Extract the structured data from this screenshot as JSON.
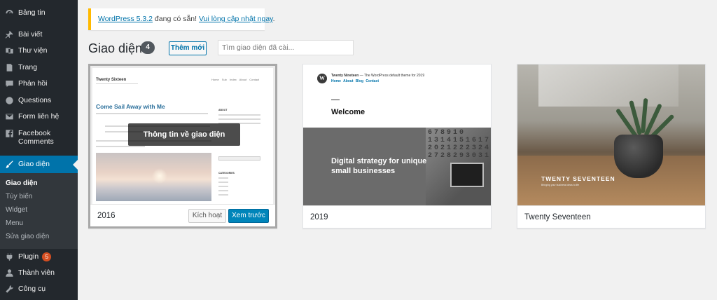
{
  "sidebar": {
    "items": [
      {
        "label": "Bảng tin",
        "icon": "dashboard-icon"
      },
      {
        "label": "Bài viết",
        "icon": "pin-icon"
      },
      {
        "label": "Thư viện",
        "icon": "media-icon"
      },
      {
        "label": "Trang",
        "icon": "page-icon"
      },
      {
        "label": "Phản hồi",
        "icon": "comment-icon"
      },
      {
        "label": "Questions",
        "icon": "question-icon"
      },
      {
        "label": "Form liên hệ",
        "icon": "mail-icon"
      },
      {
        "label": "Facebook Comments",
        "icon": "facebook-icon"
      },
      {
        "label": "Giao diện",
        "icon": "brush-icon",
        "active": true
      },
      {
        "label": "Plugin",
        "icon": "plugin-icon",
        "badge": "5"
      },
      {
        "label": "Thành viên",
        "icon": "user-icon"
      },
      {
        "label": "Công cụ",
        "icon": "wrench-icon"
      }
    ],
    "submenu": [
      "Giao diện",
      "Tùy biến",
      "Widget",
      "Menu",
      "Sửa giao diện"
    ]
  },
  "notice": {
    "version_link": "WordPress 5.3.2",
    "middle": " đang có sẵn! ",
    "update_link": "Vui lòng cập nhật ngay",
    "end": "."
  },
  "header": {
    "title": "Giao diện",
    "count": "4",
    "add_new": "Thêm mới",
    "search_placeholder": "Tìm giao diện đã cài..."
  },
  "themes": [
    {
      "name": "2016",
      "overlay": "Thông tin về giao diện",
      "activate": "Kích hoạt",
      "preview": "Xem trước",
      "shot": {
        "site_title": "Twenty Sixteen",
        "nav": "Home Sub Index About Contact",
        "headline": "Come Sail Away with Me",
        "sidebar_1": "ABOUT",
        "sidebar_2": "CATEGORIES"
      }
    },
    {
      "name": "2019",
      "shot": {
        "logo": "W",
        "site_bold": "Twenty Nineteen",
        "site_rest": " — The WordPress default theme for 2019",
        "nav": "Home About Blog Contact",
        "welcome": "Welcome",
        "headline": "Digital strategy for unique small businesses",
        "calendar": "678910\n1314151617\n2021222324\n2728293031"
      }
    },
    {
      "name": "Twenty Seventeen",
      "shot": {
        "title": "TWENTY SEVENTEEN",
        "tagline": "Bringing your business ideas to life"
      }
    }
  ],
  "colors": {
    "sidebar_bg": "#23282d",
    "active_bg": "#0073aa",
    "link": "#0073aa",
    "notice_border": "#ffb900",
    "badge": "#d54e21",
    "primary_button": "#0085ba"
  }
}
